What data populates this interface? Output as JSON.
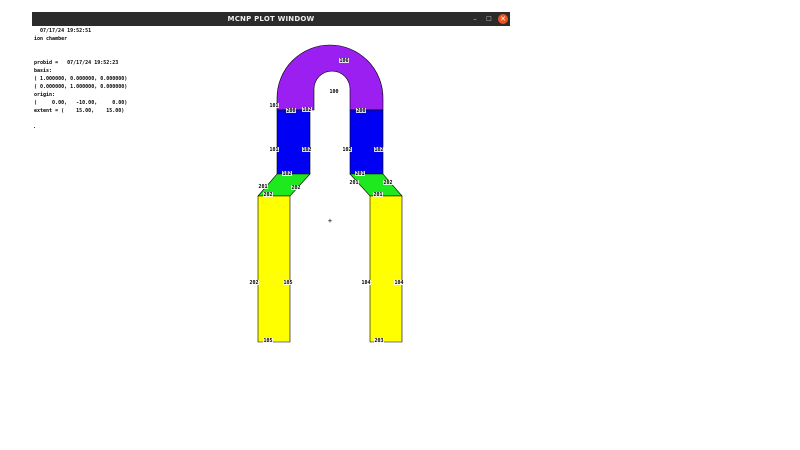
{
  "window": {
    "title": "MCNP PLOT WINDOW",
    "controls": {
      "minimize": "–",
      "maximize": "□",
      "close": "✕"
    }
  },
  "info": {
    "timestamp": "07/17/24 19:52:51",
    "title": "ion chamber",
    "probid": "probid =   07/17/24 19:52:23",
    "basis_label": "basis:",
    "basis_1": "( 1.000000, 0.000000, 0.000000)",
    "basis_2": "( 0.000000, 1.000000, 0.000000)",
    "origin_label": "origin:",
    "origin_value": "(     0.00,   -10.00,     0.00)",
    "extent": "extent = (    15.00,    15.00)",
    "dot": "."
  },
  "colors": {
    "arch": "#9b1ff0",
    "leg_upper": "#0000f5",
    "connector": "#1ee81e",
    "leg_lower": "#ffff00",
    "outline": "#000000"
  },
  "cells": [
    {
      "text": "106"
    },
    {
      "text": "100"
    },
    {
      "text": "101"
    },
    {
      "text": "200"
    },
    {
      "text": "102"
    },
    {
      "text": "200"
    },
    {
      "text": "101"
    },
    {
      "text": "102"
    },
    {
      "text": "102"
    },
    {
      "text": "102"
    },
    {
      "text": "102"
    },
    {
      "text": "201"
    },
    {
      "text": "201"
    },
    {
      "text": "202"
    },
    {
      "text": "201"
    },
    {
      "text": "202"
    },
    {
      "text": "202"
    },
    {
      "text": "201"
    },
    {
      "text": "202"
    },
    {
      "text": "105"
    },
    {
      "text": "104"
    },
    {
      "text": "104"
    },
    {
      "text": "105"
    },
    {
      "text": "203"
    },
    {
      "text": "203"
    }
  ],
  "crosshair": "+"
}
